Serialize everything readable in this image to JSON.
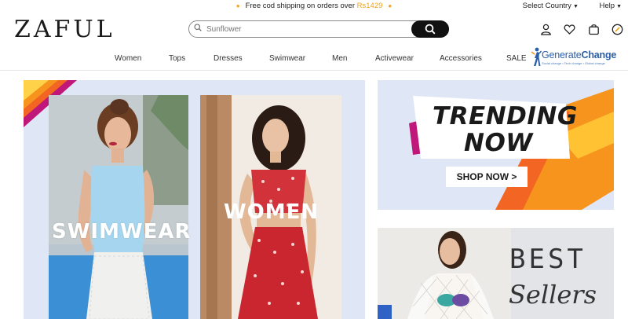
{
  "promo": {
    "text": "Free cod shipping on orders over ",
    "amount": "Rs1429"
  },
  "top_links": {
    "country": "Select Country",
    "help": "Help"
  },
  "brand": {
    "logo": "ZAFUL"
  },
  "search": {
    "placeholder": "Sunflower"
  },
  "header_icons": [
    "user-icon",
    "heart-icon",
    "bag-icon",
    "compass-icon"
  ],
  "nav": {
    "items": [
      "Women",
      "Tops",
      "Dresses",
      "Swimwear",
      "Men",
      "Activewear",
      "Accessories",
      "SALE"
    ]
  },
  "overlay_logo": {
    "name_part1": "Generate",
    "name_part2": "Change",
    "tagline": "Social change • Tech change • Global change"
  },
  "hero": {
    "swim_label": "SWIMWEAR",
    "women_label": "WOMEN"
  },
  "trending": {
    "line1": "TRENDING",
    "line2": "NOW",
    "button": "SHOP NOW >"
  },
  "best_sellers": {
    "line1": "BEST",
    "line2": "Sellers"
  },
  "colors": {
    "accent": "#f2a21b",
    "dark": "#111111",
    "hero_bg": "#dfe6f6",
    "orange": "#f7941d",
    "magenta": "#c0187a"
  }
}
